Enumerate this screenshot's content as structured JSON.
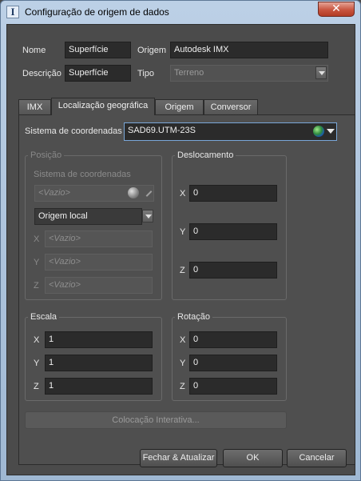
{
  "window": {
    "title": "Configuração de origem de dados",
    "app_icon_glyph": "I"
  },
  "header": {
    "nome_label": "Nome",
    "nome_value": "Superfície",
    "origem_label": "Origem",
    "origem_value": "Autodesk IMX",
    "descricao_label": "Descrição",
    "descricao_value": "Superfície",
    "tipo_label": "Tipo",
    "tipo_value": "Terreno"
  },
  "tabs": [
    {
      "label": "IMX"
    },
    {
      "label": "Localização geográfica"
    },
    {
      "label": "Origem"
    },
    {
      "label": "Conversor"
    }
  ],
  "active_tab": "Localização geográfica",
  "geo": {
    "crs_label": "Sistema de coordenadas",
    "crs_value": "SAD69.UTM-23S",
    "posicao": {
      "title": "Posição",
      "crs_label": "Sistema de coordenadas",
      "crs_value": "<Vazio>",
      "origin_mode": "Origem local",
      "x_label": "X",
      "x_value": "<Vazio>",
      "y_label": "Y",
      "y_value": "<Vazio>",
      "z_label": "Z",
      "z_value": "<Vazio>"
    },
    "deslocamento": {
      "title": "Deslocamento",
      "x_label": "X",
      "x_value": "0",
      "y_label": "Y",
      "y_value": "0",
      "z_label": "Z",
      "z_value": "0"
    },
    "escala": {
      "title": "Escala",
      "x_label": "X",
      "x_value": "1",
      "y_label": "Y",
      "y_value": "1",
      "z_label": "Z",
      "z_value": "1"
    },
    "rotacao": {
      "title": "Rotação",
      "x_label": "X",
      "x_value": "0",
      "y_label": "Y",
      "y_value": "0",
      "z_label": "Z",
      "z_value": "0"
    },
    "interactive_placement": "Colocação Interativa..."
  },
  "footer": {
    "close_update": "Fechar & Atualizar",
    "ok": "OK",
    "cancel": "Cancelar"
  },
  "colors": {
    "dialog_bg": "#4b4b4b",
    "field_bg": "#2b2b2b",
    "titlebar": "#bcd0e6",
    "close_button": "#c8553f",
    "highlight_border": "#7aa7d8"
  },
  "icons": {
    "crs_globe": "globe-icon",
    "crs_dropdown": "chevron-down-icon",
    "window_close": "close-icon"
  }
}
